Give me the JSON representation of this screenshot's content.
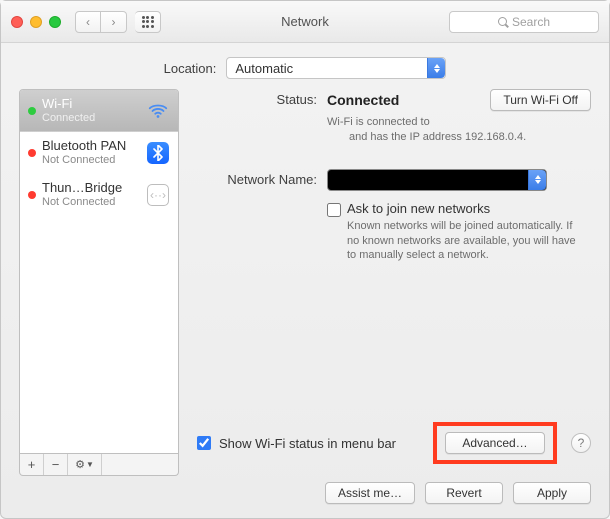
{
  "window": {
    "title": "Network",
    "search_placeholder": "Search"
  },
  "location": {
    "label": "Location:",
    "value": "Automatic"
  },
  "services": [
    {
      "name": "Wi-Fi",
      "status": "Connected",
      "color": "green",
      "icon": "wifi-icon",
      "selected": true
    },
    {
      "name": "Bluetooth PAN",
      "status": "Not Connected",
      "color": "red",
      "icon": "bluetooth-icon",
      "selected": false
    },
    {
      "name": "Thun…Bridge",
      "status": "Not Connected",
      "color": "red",
      "icon": "thunderbolt-bridge-icon",
      "selected": false
    }
  ],
  "sidebar_buttons": {
    "add": "+",
    "remove": "−",
    "actions": "⚙︎▾"
  },
  "status": {
    "label": "Status:",
    "value": "Connected",
    "toggle_label": "Turn Wi-Fi Off",
    "desc_line1": "Wi-Fi is connected to",
    "desc_line2": "and has the IP address 192.168.0.4."
  },
  "network_name": {
    "label": "Network Name:",
    "value": ""
  },
  "ask": {
    "label": "Ask to join new networks",
    "desc": "Known networks will be joined automatically. If no known networks are available, you will have to manually select a network.",
    "checked": false
  },
  "menubar": {
    "label": "Show Wi-Fi status in menu bar",
    "checked": true
  },
  "buttons": {
    "advanced": "Advanced…",
    "assist": "Assist me…",
    "revert": "Revert",
    "apply": "Apply"
  }
}
